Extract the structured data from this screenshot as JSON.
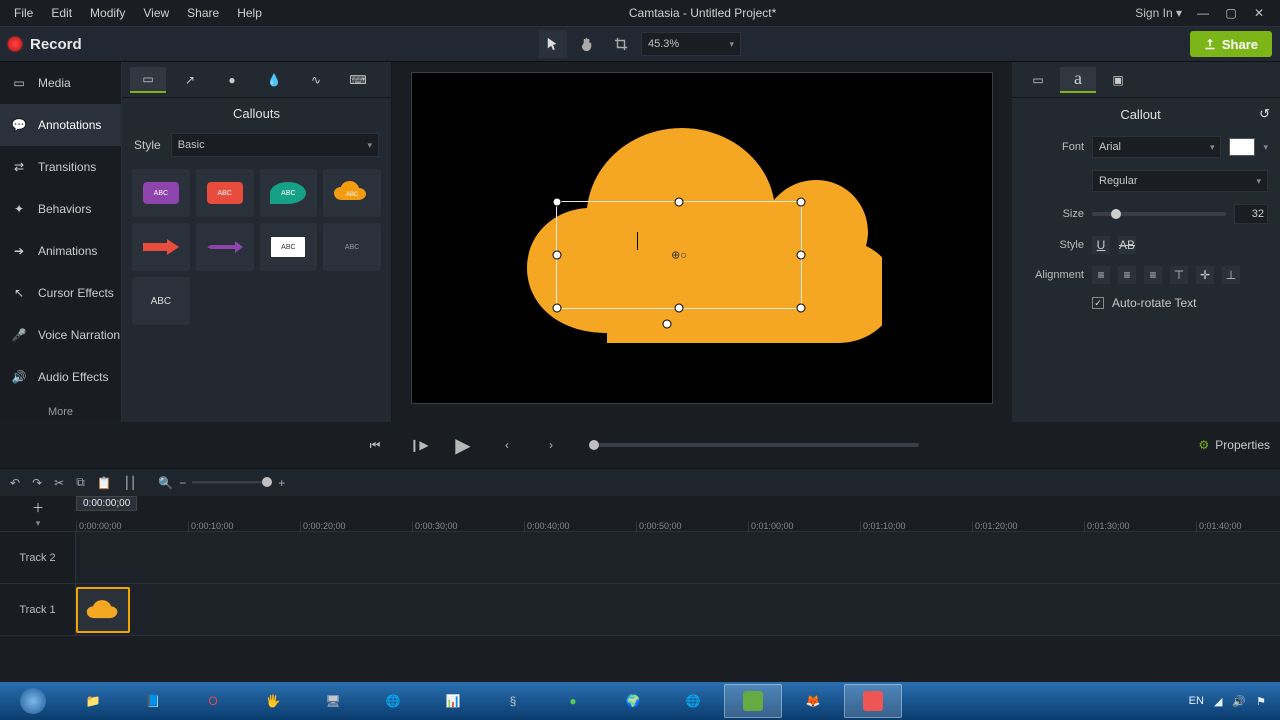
{
  "menu": [
    "File",
    "Edit",
    "Modify",
    "View",
    "Share",
    "Help"
  ],
  "title": "Camtasia - Untitled Project*",
  "signIn": "Sign In",
  "record": "Record",
  "zoom": "45.3%",
  "share": "Share",
  "sidebar": [
    {
      "label": "Media"
    },
    {
      "label": "Annotations"
    },
    {
      "label": "Transitions"
    },
    {
      "label": "Behaviors"
    },
    {
      "label": "Animations"
    },
    {
      "label": "Cursor Effects"
    },
    {
      "label": "Voice Narration"
    },
    {
      "label": "Audio Effects"
    }
  ],
  "sidebarMore": "More",
  "panel": {
    "title": "Callouts",
    "styleLabel": "Style",
    "styleValue": "Basic",
    "thumbs": [
      "ABC",
      "ABC",
      "ABC",
      "ABC",
      "",
      "",
      "ABC",
      "ABC",
      "ABC"
    ]
  },
  "props": {
    "title": "Callout",
    "fontLabel": "Font",
    "fontValue": "Arial",
    "fontStyle": "Regular",
    "sizeLabel": "Size",
    "sizeValue": "32",
    "styleLabel": "Style",
    "alignLabel": "Alignment",
    "autoRotate": "Auto-rotate Text"
  },
  "propsBtn": "Properties",
  "timeline": {
    "pos": "0:00:00;00",
    "ticks": [
      "0:00:00;00",
      "0:00:10;00",
      "0:00:20;00",
      "0:00:30;00",
      "0:00:40;00",
      "0:00:50;00",
      "0:01:00;00",
      "0:01:10;00",
      "0:01:20;00",
      "0:01:30;00",
      "0:01:40;00"
    ],
    "tracks": [
      "Track 2",
      "Track 1"
    ]
  },
  "taskbar": {
    "lang": "EN"
  }
}
